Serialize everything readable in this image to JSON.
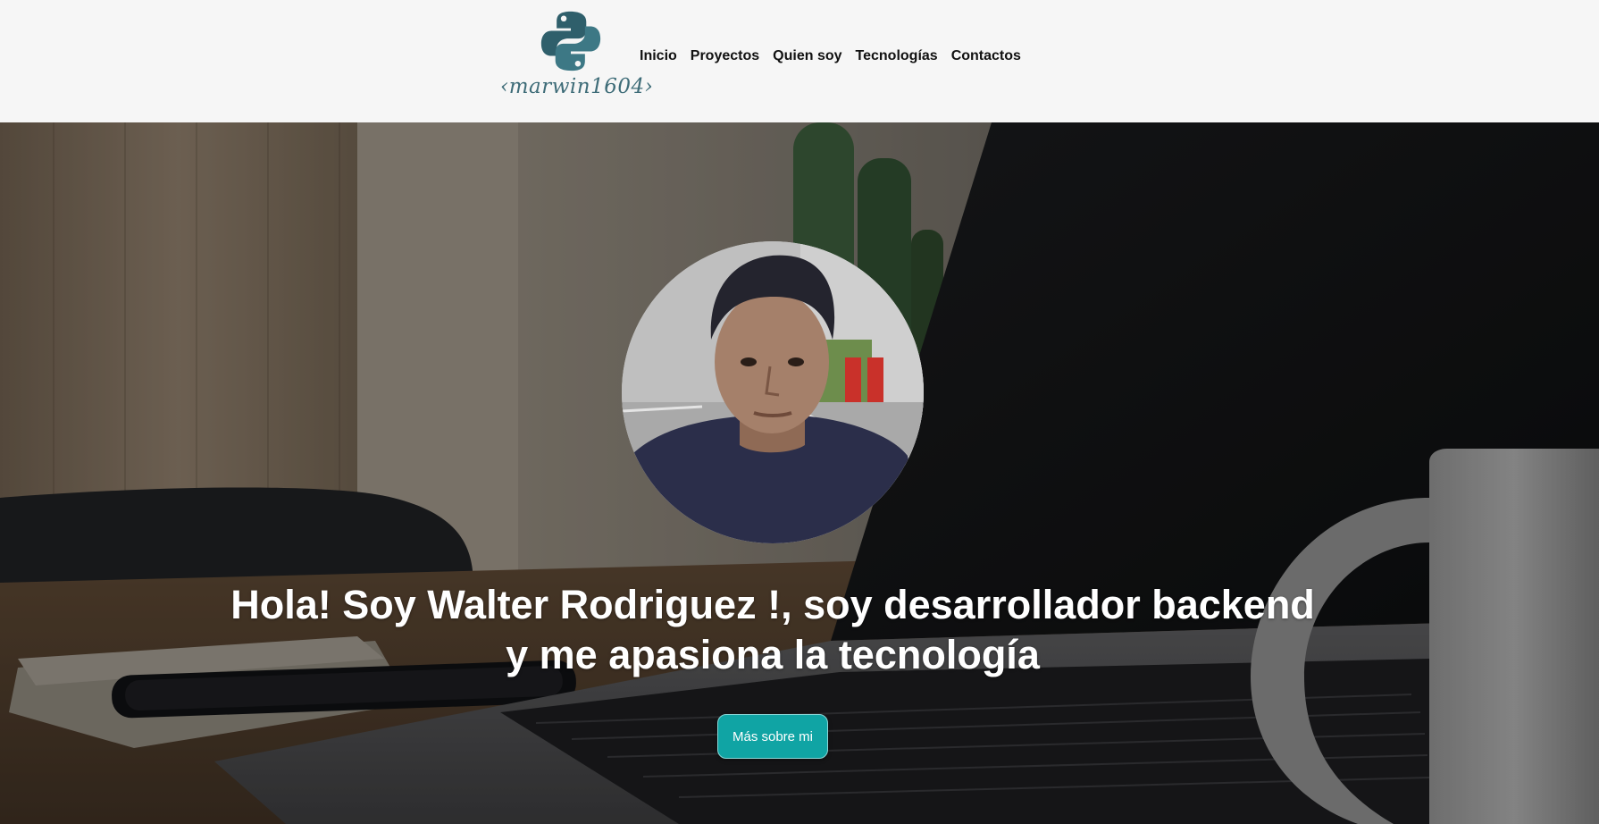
{
  "header": {
    "brand_text": "‹marwin1604›",
    "nav": [
      {
        "label": "Inicio"
      },
      {
        "label": "Proyectos"
      },
      {
        "label": "Quien soy"
      },
      {
        "label": "Tecnologías"
      },
      {
        "label": "Contactos"
      }
    ]
  },
  "hero": {
    "headline_line1": "Hola! Soy Walter Rodriguez !, soy desarrollador backend",
    "headline_line2": "y me apasiona la tecnología",
    "cta_label": "Más sobre mi"
  },
  "colors": {
    "header_bg": "#f6f6f6",
    "brand": "#2f5f6b",
    "cta": "#10a4a4",
    "headline": "#ffffff"
  },
  "icons": {
    "logo": "python-logo-icon"
  }
}
